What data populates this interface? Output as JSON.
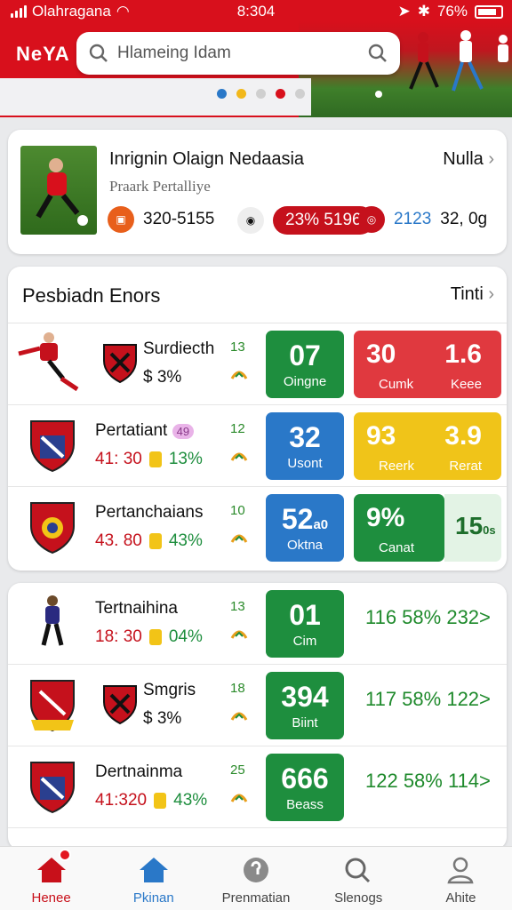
{
  "status_bar": {
    "carrier": "Olahragana",
    "time": "8:304",
    "battery": "76%"
  },
  "header": {
    "logo": "NeYA",
    "search": {
      "placeholder": "Hlameing Idam"
    },
    "carousel_dots": [
      "#2a78c8",
      "#f2b81b",
      "#cfcfcf",
      "#d8101c",
      "#cfcfcf"
    ]
  },
  "featured": {
    "title": "Inrignin Olaign Nedaasia",
    "subtitle": "Praark Pertalliye",
    "more_label": "Nulla",
    "stats": {
      "a": "320-5155",
      "b": "23% 5196",
      "c": "2123",
      "d": "32, 0g"
    }
  },
  "section1": {
    "title": "Pesbiadn Enors",
    "more_label": "Tinti",
    "rows": [
      {
        "name": "Surdiecth",
        "meta": "$ 3%",
        "rank": "13",
        "tile": {
          "big": "07",
          "label": "Oingne",
          "color": "#1e8e3e"
        },
        "tile2": {
          "a": "30",
          "b": "1.6",
          "la": "Cumk",
          "lb": "Keee",
          "color": "#e0393f"
        }
      },
      {
        "name": "Pertatiant",
        "badge": "49",
        "meta_value": "41: 30",
        "meta_pct": "13%",
        "rank": "12",
        "tile": {
          "big": "32",
          "label": "Usont",
          "color": "#2a78c8"
        },
        "tile2": {
          "a": "93",
          "b": "3.9",
          "la": "Reerk",
          "lb": "Rerat",
          "color": "#f0c419"
        }
      },
      {
        "name": "Pertanchaians",
        "meta_value": "43. 80",
        "meta_pct": "43%",
        "rank": "10",
        "tile": {
          "big": "52",
          "small": "a0",
          "label": "Oktna",
          "color": "#2a78c8"
        },
        "tile2": {
          "a": "9%",
          "la": "Canat",
          "b": "15",
          "small": "0s",
          "color": "#1e8e3e"
        }
      }
    ]
  },
  "section2": {
    "rows": [
      {
        "name": "Tertnaihina",
        "meta_value": "18: 30",
        "meta_pct": "04%",
        "rank": "13",
        "tile": {
          "big": "01",
          "label": "Cim",
          "color": "#1e8e3e"
        },
        "right": "116 58% 232>"
      },
      {
        "name": "Smgris",
        "meta": "$ 3%",
        "rank": "18",
        "tile": {
          "big": "394",
          "label": "Biint",
          "color": "#1e8e3e"
        },
        "right": "117 58% 122>"
      },
      {
        "name": "Dertnainma",
        "meta_value": "41:320",
        "meta_pct": "43%",
        "rank": "25",
        "tile": {
          "big": "666",
          "label": "Beass",
          "color": "#1e8e3e"
        },
        "right": "122 58% 114>"
      }
    ]
  },
  "nav": [
    {
      "label": "Henee",
      "icon": "home-icon"
    },
    {
      "label": "Pkinan",
      "icon": "home-icon"
    },
    {
      "label": "Prenmatian",
      "icon": "info-icon"
    },
    {
      "label": "Slenogs",
      "icon": "search-icon"
    },
    {
      "label": "Ahite",
      "icon": "profile-icon"
    }
  ]
}
